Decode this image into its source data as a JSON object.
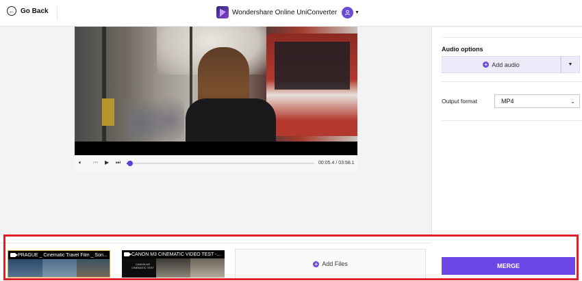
{
  "header": {
    "back_label": "Go Back",
    "brand_name": "Wondershare Online UniConverter"
  },
  "player": {
    "current_time": "00:05.4",
    "separator": "/",
    "duration": "03:58.1",
    "progress_fraction": 0.02
  },
  "settings": {
    "audio_title": "Audio options",
    "add_audio_label": "Add audio",
    "output_format_label": "Output format",
    "output_format_value": "MP4"
  },
  "clips": [
    {
      "title": "PRAGUE _ Cinematic Travel Film _ Son..."
    },
    {
      "title": "CANON M3 CINEMATIC VIDEO TEST -...",
      "thumb_text": "CANON M3\nCINEMATIC TEST"
    }
  ],
  "add_files_label": "Add Files",
  "merge_label": "MERGE",
  "colors": {
    "accent": "#6c47e6",
    "highlight_border": "#e01f26"
  }
}
